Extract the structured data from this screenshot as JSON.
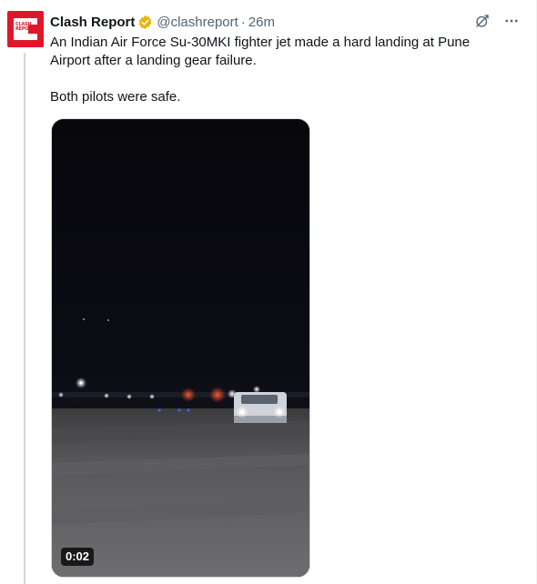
{
  "tweet": {
    "author_name": "Clash Report",
    "author_handle": "@clashreport",
    "separator": "·",
    "timestamp": "26m",
    "avatar_logo_text": "CLASH REPORT",
    "text_paragraphs": [
      "An Indian Air Force Su-30MKI fighter jet made a hard landing at Pune Airport after a landing gear failure.",
      "Both pilots were safe."
    ],
    "verified_badge_color": "#e9b308",
    "media": {
      "type": "video",
      "duration": "0:02"
    }
  },
  "icons": {
    "verified": "verified-badge-icon",
    "grok": "grok-icon",
    "more": "more-options-icon"
  },
  "colors": {
    "text_primary": "#0f1419",
    "text_secondary": "#536471",
    "brand_red": "#e0162b",
    "thread_line": "#cfd9de"
  }
}
